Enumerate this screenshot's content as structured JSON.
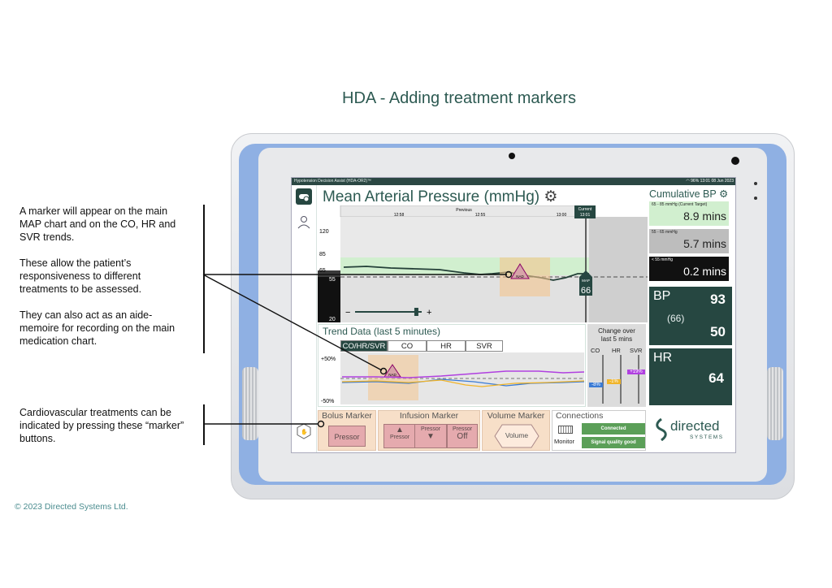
{
  "page": {
    "title": "HDA - Adding treatment markers",
    "copyright": "© 2023 Directed Systems Ltd."
  },
  "annotations": {
    "marker_note": [
      "A marker will appear on the main",
      "MAP chart and on the CO, HR and",
      "SVR trends.",
      "",
      "These allow the patient’s",
      "responsiveness to different",
      "treatments to be assessed.",
      "",
      "They can also act as an aide-",
      "memoire for recording on the main",
      "medication chart."
    ],
    "buttons_note": [
      "Cardiovascular treatments can be",
      "indicated by pressing these “marker”",
      "buttons."
    ]
  },
  "app": {
    "status_bar_left": "Hypotension Decision Assist (HDA-OR2)™",
    "status_bar_right": "13:01   08 Jun 2023",
    "status_battery": "96%",
    "map_title": "Mean Arterial Pressure (mmHg)",
    "map_chart": {
      "header_label": "Previous",
      "time_ticks": [
        "12:58",
        "12:55",
        "13:00"
      ],
      "current_label": "Current",
      "current_time": "13:01",
      "y_ticks": [
        "120",
        "85",
        "65",
        "55",
        "20"
      ],
      "map_label": "MAP",
      "map_value": "66",
      "marker_label": "NAD",
      "zoom_minus": "−",
      "zoom_plus": "+",
      "zoom_level": 0.92
    },
    "trend": {
      "title": "Trend Data (last 5 minutes)",
      "tabs": [
        "CO/HR/SVR",
        "CO",
        "HR",
        "SVR"
      ],
      "y_top": "+50%",
      "y_bottom": "-50%",
      "marker_label": "NAD",
      "change_title": "Change over last 5 mins",
      "change_cols": [
        "CO",
        "HR",
        "SVR"
      ],
      "change_values": [
        "-8%",
        "-1%",
        "+19%"
      ],
      "colors": {
        "co": "#3a7bd5",
        "hr": "#f0b429",
        "svr": "#b040e0"
      }
    },
    "cumulative": {
      "title": "Cumulative BP",
      "items": [
        {
          "label": "65 - 85 mmHg (Current Target)",
          "value": "8.9 mins"
        },
        {
          "label": "55 - 65 mmHg",
          "value": "5.7 mins"
        },
        {
          "label": "< 55 mmHg",
          "value": "0.2 mins"
        }
      ]
    },
    "bp": {
      "label": "BP",
      "systolic": "93",
      "map": "(66)",
      "diastolic": "50"
    },
    "hr": {
      "label": "HR",
      "value": "64"
    },
    "bolus": {
      "title": "Bolus Marker",
      "button": "Pressor"
    },
    "infusion": {
      "title": "Infusion Marker",
      "up": "Pressor",
      "down": "Pressor",
      "off_top": "Pressor",
      "off_bottom": "Off"
    },
    "volume": {
      "title": "Volume Marker",
      "button": "Volume"
    },
    "connections": {
      "title": "Connections",
      "monitor": "Monitor",
      "status1": "Connected",
      "status2": "Signal quality good"
    },
    "logo": {
      "word1": "directed",
      "word2": "SYSTEMS"
    }
  }
}
